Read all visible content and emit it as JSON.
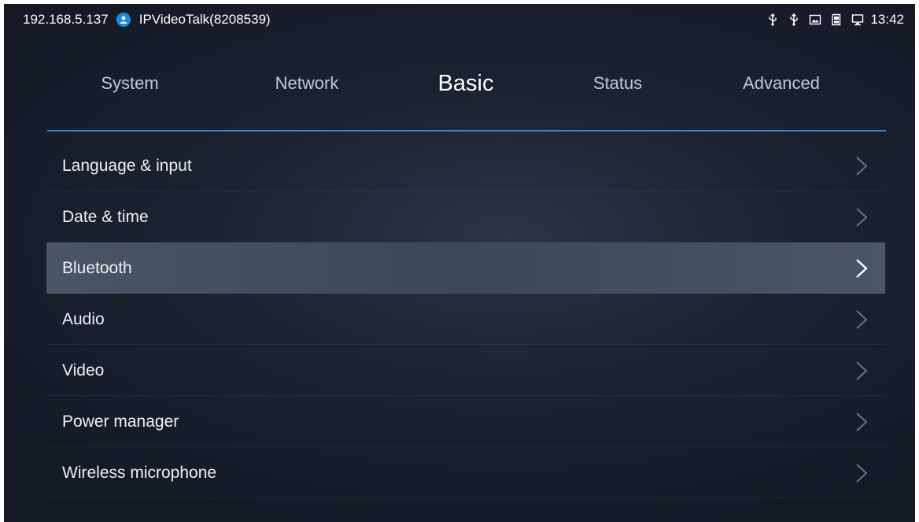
{
  "status_bar": {
    "ip": "192.168.5.137",
    "account": "IPVideoTalk(8208539)",
    "account_icon": "person-icon",
    "indicator_icons": [
      "usb-icon",
      "usb-icon",
      "screen-capture-icon",
      "sd-card-icon",
      "tv-icon"
    ],
    "time": "13:42"
  },
  "tabs": [
    {
      "label": "System",
      "active": false
    },
    {
      "label": "Network",
      "active": false
    },
    {
      "label": "Basic",
      "active": true
    },
    {
      "label": "Status",
      "active": false
    },
    {
      "label": "Advanced",
      "active": false
    }
  ],
  "menu": {
    "items": [
      {
        "label": "Language & input",
        "selected": false
      },
      {
        "label": "Date & time",
        "selected": false
      },
      {
        "label": "Bluetooth",
        "selected": true
      },
      {
        "label": "Audio",
        "selected": false
      },
      {
        "label": "Video",
        "selected": false
      },
      {
        "label": "Power manager",
        "selected": false
      },
      {
        "label": "Wireless microphone",
        "selected": false
      }
    ]
  },
  "colors": {
    "background": "#1c2330",
    "accent_line": "#3b86cf",
    "account_badge": "#1e8ce6",
    "selected_row": "#465264"
  }
}
